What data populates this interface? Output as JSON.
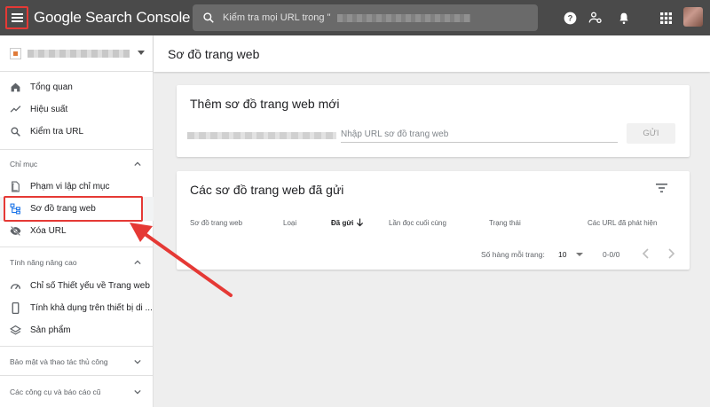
{
  "header": {
    "app_title": "Google Search Console",
    "search_placeholder": "Kiểm tra mọi URL trong \""
  },
  "sidebar": {
    "items": [
      {
        "label": "Tổng quan",
        "icon": "home-icon"
      },
      {
        "label": "Hiệu suất",
        "icon": "trending-icon"
      },
      {
        "label": "Kiểm tra URL",
        "icon": "search-icon"
      }
    ],
    "sections": {
      "index": {
        "title": "Chỉ mục",
        "items": [
          {
            "label": "Phạm vi lập chỉ mục",
            "icon": "file-icon"
          },
          {
            "label": "Sơ đồ trang web",
            "icon": "sitemap-icon"
          },
          {
            "label": "Xóa URL",
            "icon": "visibility-off-icon"
          }
        ]
      },
      "enhancements": {
        "title": "Tính năng nâng cao",
        "items": [
          {
            "label": "Chỉ số Thiết yếu về Trang web",
            "icon": "speed-icon"
          },
          {
            "label": "Tính khả dụng trên thiết bị di ...",
            "icon": "phone-icon"
          },
          {
            "label": "Sản phẩm",
            "icon": "layers-icon"
          }
        ]
      },
      "security": {
        "title": "Bảo mật và thao tác thủ công"
      },
      "legacy": {
        "title": "Các công cụ và báo cáo cũ"
      }
    }
  },
  "page": {
    "title": "Sơ đồ trang web"
  },
  "add_sitemap": {
    "title": "Thêm sơ đồ trang web mới",
    "input_placeholder": "Nhập URL sơ đồ trang web",
    "submit_label": "GỬI"
  },
  "submitted": {
    "title": "Các sơ đồ trang web đã gửi",
    "columns": [
      "Sơ đồ trang web",
      "Loại",
      "Đã gửi",
      "Lần đọc cuối cùng",
      "Trạng thái",
      "Các URL đã phát hiện"
    ],
    "rows_per_page_label": "Số hàng mỗi trang:",
    "rows_per_page_value": "10",
    "range": "0-0/0"
  },
  "colors": {
    "topbar": "#4a4a4a",
    "highlight": "#e53935"
  }
}
